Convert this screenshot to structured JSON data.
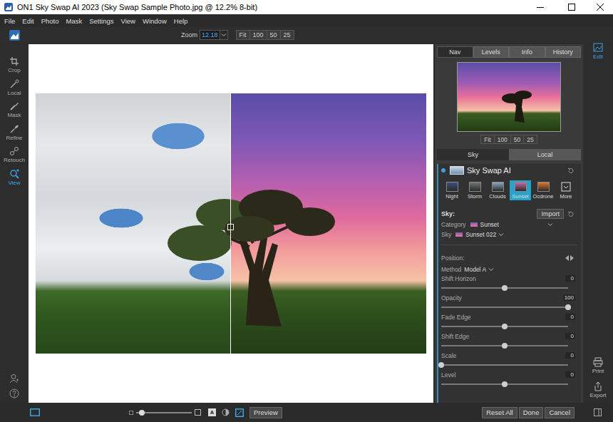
{
  "window": {
    "title": "ON1 Sky Swap AI 2023 (Sky Swap Sample Photo.jpg @ 12.2% 8-bit)"
  },
  "menu": [
    "File",
    "Edit",
    "Photo",
    "Mask",
    "Settings",
    "View",
    "Window",
    "Help"
  ],
  "toolbar": {
    "zoom_label": "Zoom",
    "zoom_value": "12.18",
    "zoom_presets": [
      "Fit",
      "100",
      "50",
      "25"
    ]
  },
  "tools": [
    {
      "label": "Crop",
      "selected": false
    },
    {
      "label": "Local",
      "selected": false
    },
    {
      "label": "Mask",
      "selected": false
    },
    {
      "label": "Refine",
      "selected": false
    },
    {
      "label": "Retouch",
      "selected": false
    },
    {
      "label": "View",
      "selected": true
    }
  ],
  "image": {
    "split_level": 0.5
  },
  "info_tabs": [
    {
      "label": "Nav",
      "selected": true
    },
    {
      "label": "Levels",
      "selected": false
    },
    {
      "label": "Info",
      "selected": false
    },
    {
      "label": "History",
      "selected": false
    }
  ],
  "navigator": {
    "zoom_presets": [
      "Fit",
      "100",
      "50",
      "25"
    ]
  },
  "mode_tabs": [
    {
      "label": "Sky",
      "selected": true
    },
    {
      "label": "Local",
      "selected": false
    }
  ],
  "sky_swap": {
    "title": "Sky Swap AI",
    "enabled": true,
    "presets": [
      {
        "label": "Night",
        "selected": false,
        "kind": "thumb",
        "color": "#3b4f7a"
      },
      {
        "label": "Storm",
        "selected": false,
        "kind": "thumb",
        "color": "#6f7378"
      },
      {
        "label": "Clouds",
        "selected": false,
        "kind": "thumb",
        "color": "#8fa6bf"
      },
      {
        "label": "Sunset",
        "selected": true,
        "kind": "thumb",
        "color": "#c76aa8"
      },
      {
        "label": "Ocdrone",
        "selected": false,
        "kind": "thumb",
        "color": "#e0782e"
      },
      {
        "label": "More",
        "selected": false,
        "kind": "icon",
        "color": "#dddddd"
      }
    ],
    "sky_label": "Sky:",
    "import_button": "Import",
    "category": {
      "label": "Category",
      "value": "Sunset"
    },
    "sky": {
      "label": "Sky",
      "value": "Sunset 022"
    },
    "position_label": "Position:",
    "method": {
      "label": "Method",
      "value": "Model A"
    },
    "sliders": [
      {
        "label": "Shift Horizon",
        "value": "0",
        "level": 0.5
      },
      {
        "label": "Opacity",
        "value": "100",
        "level": 1
      },
      {
        "label": "Fade Edge",
        "value": "0",
        "level": 0.5
      },
      {
        "label": "Shift Edge",
        "value": "0",
        "level": 0.5
      },
      {
        "label": "Scale",
        "value": "0",
        "level": 0
      },
      {
        "label": "Level",
        "value": "0",
        "level": 0.5
      }
    ]
  },
  "side_modules": [
    {
      "label": "Edit",
      "selected": true
    },
    {
      "label": "Print",
      "selected": false
    },
    {
      "label": "Export",
      "selected": false
    }
  ],
  "bottom_bar": {
    "mask_view": {
      "level": 0.1
    },
    "overlay_key": "A",
    "preview_button": "Preview",
    "buttons": [
      "Reset All",
      "Done",
      "Cancel"
    ]
  }
}
